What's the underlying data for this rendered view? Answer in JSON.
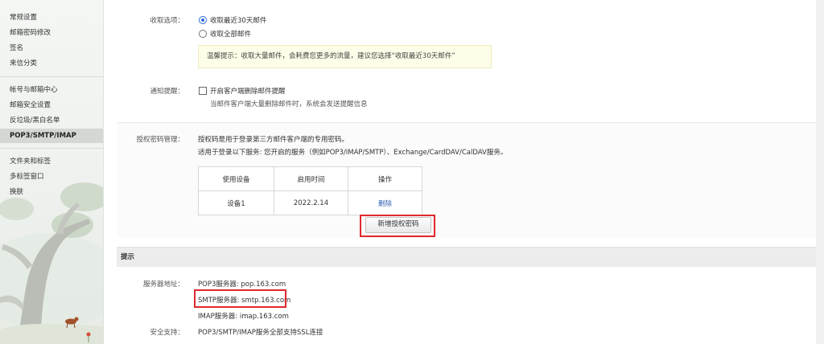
{
  "sidebar": {
    "items": [
      {
        "label": "常规设置"
      },
      {
        "label": "邮箱密码修改"
      },
      {
        "label": "签名"
      },
      {
        "label": "来信分类"
      },
      {
        "label": "帐号与邮箱中心"
      },
      {
        "label": "邮箱安全设置"
      },
      {
        "label": "反垃圾/黑白名单"
      },
      {
        "label": "POP3/SMTP/IMAP"
      },
      {
        "label": "文件夹和标签"
      },
      {
        "label": "多标签窗口"
      },
      {
        "label": "换肤"
      }
    ],
    "active": "POP3/SMTP/IMAP"
  },
  "receive": {
    "label": "收取选项：",
    "option1": "收取最近30天邮件",
    "option2": "收取全部邮件",
    "selected": "收取最近30天邮件",
    "tip": "温馨提示：收取大量邮件，会耗费您更多的流量，建议您选择“收取最近30天邮件”"
  },
  "notify": {
    "label": "通知提醒：",
    "checkbox": "开启客户端删除邮件提醒",
    "checked": false,
    "desc": "当邮件客户端大量删除邮件时，系统会发送提醒信息"
  },
  "auth": {
    "label": "授权密码管理：",
    "line1": "授权码是用于登录第三方邮件客户端的专用密码。",
    "line2": "适用于登录以下服务: 您开启的服务（例如POP3/IMAP/SMTP）、Exchange/CardDAV/CalDAV服务。",
    "columns": [
      "使用设备",
      "启用时间",
      "操作"
    ],
    "rows": [
      {
        "device": "设备1",
        "time": "2022.2.14",
        "action": "删除"
      }
    ],
    "new_button": "新增授权密码"
  },
  "hint": {
    "title": "提示",
    "server_label": "服务器地址：",
    "pop3": "POP3服务器: pop.163.com",
    "smtp": "SMTP服务器: smtp.163.com",
    "imap": "IMAP服务器: imap.163.com",
    "security_label": "安全支持：",
    "security": "POP3/SMTP/IMAP服务全部支持SSL连接"
  },
  "colors": {
    "accent": "#2f6bd6",
    "highlight_box": "#e0282c",
    "tip_bg": "#fdfde8"
  }
}
